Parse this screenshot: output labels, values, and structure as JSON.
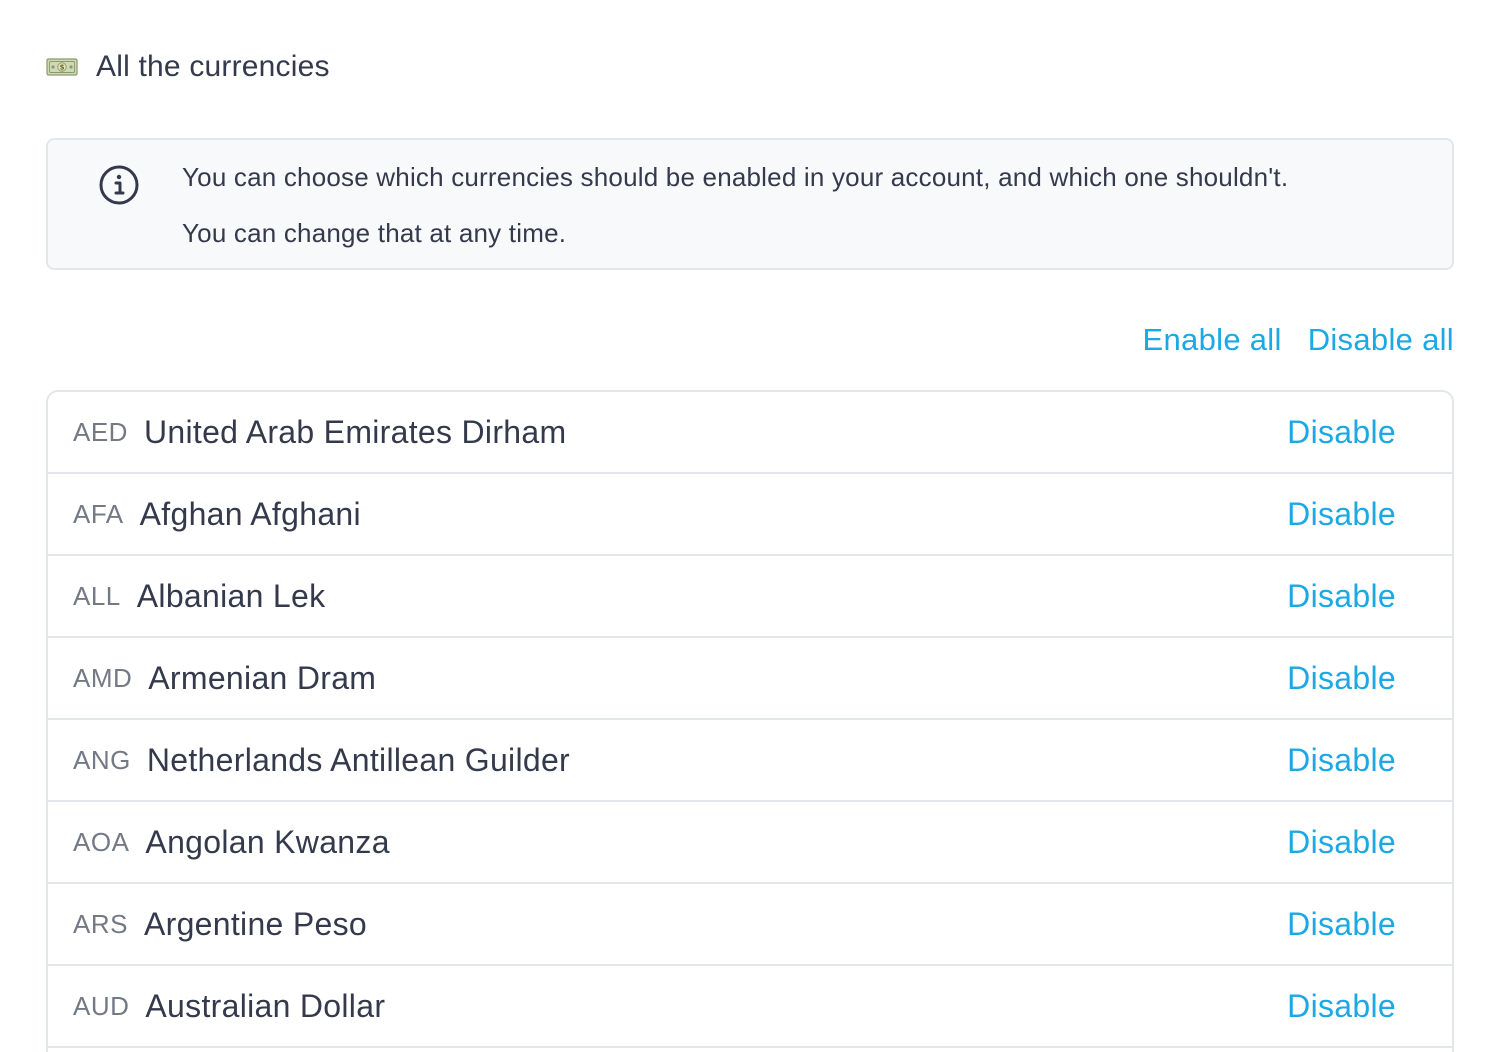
{
  "header": {
    "icon": "money-bill-icon",
    "title": "All the currencies"
  },
  "info": {
    "icon": "info-circle-icon",
    "line1": "You can choose which currencies should be enabled in your account, and which one shouldn't.",
    "line2": "You can change that at any time."
  },
  "bulk": {
    "enable_all": "Enable all",
    "disable_all": "Disable all"
  },
  "colors": {
    "accent": "#1ba8e5",
    "text": "#343a4b",
    "muted": "#737985",
    "border": "#e3e6ea",
    "info_bg": "#f8f9fb"
  },
  "currencies": [
    {
      "code": "AED",
      "name": "United Arab Emirates Dirham",
      "action": "Disable"
    },
    {
      "code": "AFA",
      "name": "Afghan Afghani",
      "action": "Disable"
    },
    {
      "code": "ALL",
      "name": "Albanian Lek",
      "action": "Disable"
    },
    {
      "code": "AMD",
      "name": "Armenian Dram",
      "action": "Disable"
    },
    {
      "code": "ANG",
      "name": "Netherlands Antillean Guilder",
      "action": "Disable"
    },
    {
      "code": "AOA",
      "name": "Angolan Kwanza",
      "action": "Disable"
    },
    {
      "code": "ARS",
      "name": "Argentine Peso",
      "action": "Disable"
    },
    {
      "code": "AUD",
      "name": "Australian Dollar",
      "action": "Disable"
    }
  ]
}
